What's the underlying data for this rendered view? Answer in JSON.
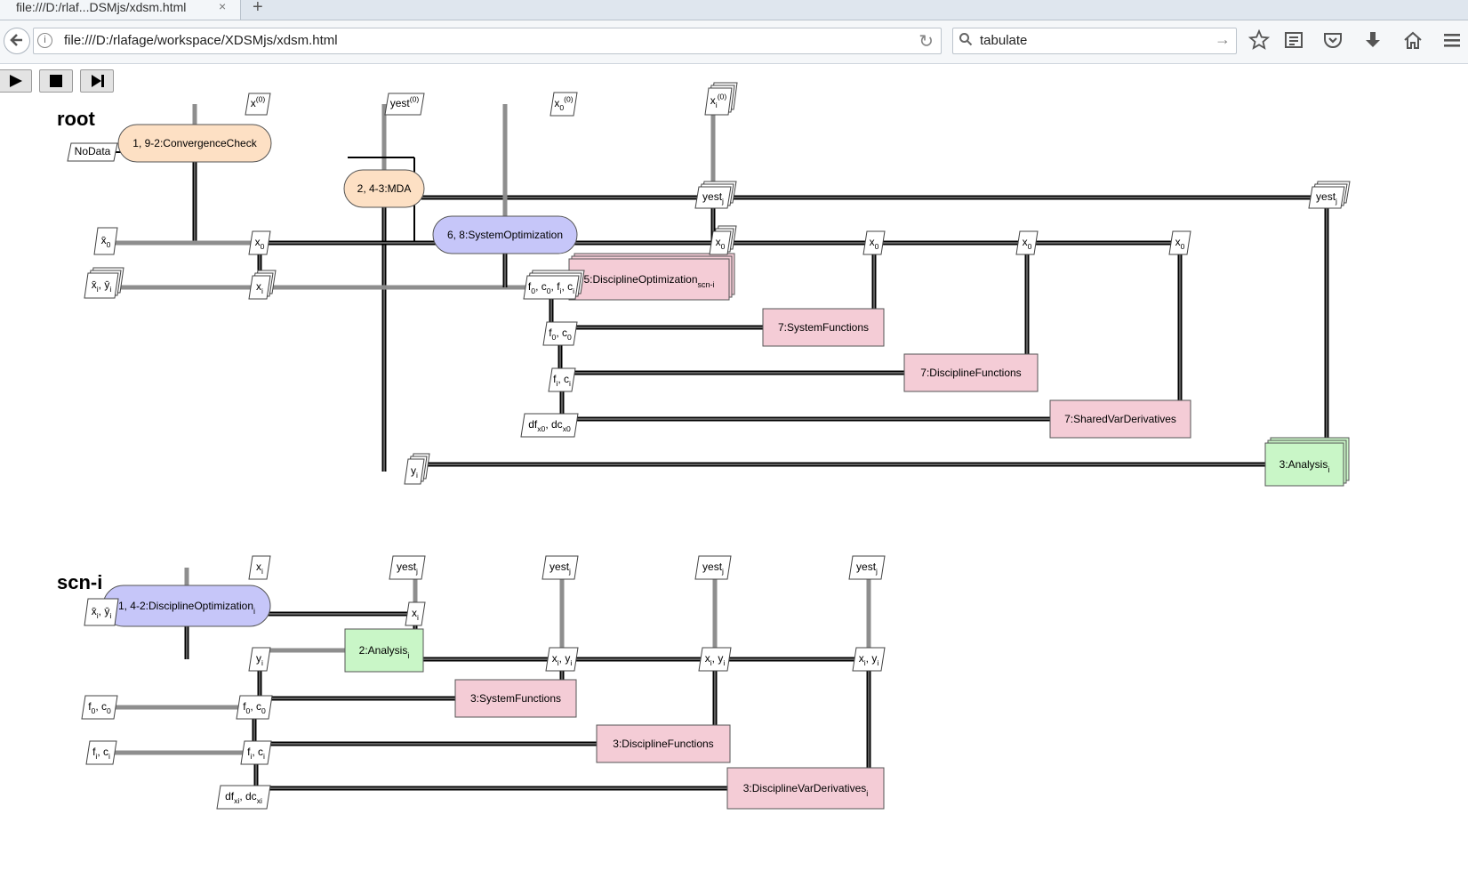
{
  "browser": {
    "tab_title": "file:///D:/rlaf...DSMjs/xdsm.html",
    "tab_close": "×",
    "new_tab": "+",
    "url": "file:///D:/rlafage/workspace/XDSMjs/xdsm.html",
    "search_value": "tabulate",
    "toolbar_icons": [
      "bookmark-star-icon",
      "reading-list-icon",
      "pocket-icon",
      "download-icon",
      "home-icon",
      "menu-icon"
    ]
  },
  "controls": [
    "play-icon",
    "stop-icon",
    "step-forward-icon"
  ],
  "colors": {
    "driver": "#fde0c4",
    "optimization": "#c6c6f9",
    "function": "#f4ccd6",
    "analysis": "#c9f6c7",
    "data": "#ffffff",
    "data_inner": "#e6e6e6"
  },
  "diagrams": [
    {
      "title": "root",
      "nodes": [
        {
          "id": "conv",
          "label": "1, 9-2:ConvergenceCheck",
          "kind": "driver"
        },
        {
          "id": "mda",
          "label": "2, 4-3:MDA",
          "kind": "driver"
        },
        {
          "id": "sysopt",
          "label": "6, 8:SystemOptimization",
          "kind": "optimization"
        },
        {
          "id": "discopt",
          "label": "5:DisciplineOptimization",
          "sub": "scn-i",
          "kind": "function",
          "multi": true
        },
        {
          "id": "sysfun",
          "label": "7:SystemFunctions",
          "kind": "function"
        },
        {
          "id": "discfun",
          "label": "7:DisciplineFunctions",
          "kind": "function"
        },
        {
          "id": "shared",
          "label": "7:SharedVarDerivatives",
          "kind": "function"
        },
        {
          "id": "ana",
          "label": "3:Analysis",
          "sub": "i",
          "kind": "analysis",
          "multi": true
        }
      ],
      "data": [
        {
          "id": "nodata",
          "label": "NoData"
        },
        {
          "id": "x0in",
          "label": "x^(0)"
        },
        {
          "id": "yestin",
          "label": "yest^(0)"
        },
        {
          "id": "x00in",
          "label": "x_0^(0)"
        },
        {
          "id": "xiin",
          "label": "x_i^(0)"
        },
        {
          "id": "yestj1",
          "label": "yest_j"
        },
        {
          "id": "yestj2",
          "label": "yest_j"
        },
        {
          "id": "x0bar",
          "label": "x̄_0"
        },
        {
          "id": "x0a",
          "label": "x_0"
        },
        {
          "id": "x0b",
          "label": "x_0"
        },
        {
          "id": "x0c",
          "label": "x_0"
        },
        {
          "id": "x0d",
          "label": "x_0"
        },
        {
          "id": "x0e",
          "label": "x_0"
        },
        {
          "id": "xybar",
          "label": "x̄_i, ȳ_i"
        },
        {
          "id": "xi",
          "label": "x_i"
        },
        {
          "id": "fc",
          "label": "f_0, c_0, f_i, c_i"
        },
        {
          "id": "f0c0",
          "label": "f_0, c_0"
        },
        {
          "id": "fici",
          "label": "f_i, c_i"
        },
        {
          "id": "dfdc",
          "label": "df_x0, dc_x0"
        },
        {
          "id": "yi",
          "label": "y_i"
        }
      ]
    },
    {
      "title": "scn-i",
      "nodes": [
        {
          "id": "dopt",
          "label": "1, 4-2:DisciplineOptimization",
          "sub": "i",
          "kind": "optimization"
        },
        {
          "id": "ana2",
          "label": "2:Analysis",
          "sub": "i",
          "kind": "analysis"
        },
        {
          "id": "sysfun2",
          "label": "3:SystemFunctions",
          "kind": "function"
        },
        {
          "id": "discfun2",
          "label": "3:DisciplineFunctions",
          "kind": "function"
        },
        {
          "id": "dvd",
          "label": "3:DisciplineVarDerivatives",
          "sub": "i",
          "kind": "function"
        }
      ],
      "data": [
        {
          "id": "xiin2",
          "label": "x_i"
        },
        {
          "id": "yj1",
          "label": "yest_j"
        },
        {
          "id": "yj2",
          "label": "yest_j"
        },
        {
          "id": "yj3",
          "label": "yest_j"
        },
        {
          "id": "yj4",
          "label": "yest_j"
        },
        {
          "id": "xyb",
          "label": "x̄_i, ȳ_i"
        },
        {
          "id": "xi2",
          "label": "x_i"
        },
        {
          "id": "yi2",
          "label": "y_i"
        },
        {
          "id": "xy1",
          "label": "x_i, y_i"
        },
        {
          "id": "xy2",
          "label": "x_i, y_i"
        },
        {
          "id": "xy3",
          "label": "x_i, y_i"
        },
        {
          "id": "f0c0in",
          "label": "f_0, c_0"
        },
        {
          "id": "f0c02",
          "label": "f_0, c_0"
        },
        {
          "id": "ficiin",
          "label": "f_i, c_i"
        },
        {
          "id": "fici2",
          "label": "f_i, c_i"
        },
        {
          "id": "dfdc2",
          "label": "df_xi, dc_xi"
        }
      ]
    }
  ]
}
